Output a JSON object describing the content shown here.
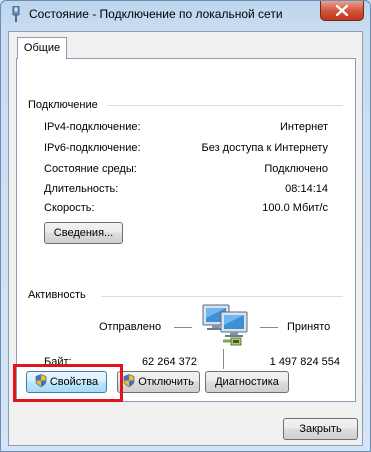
{
  "window": {
    "title": "Состояние - Подключение по локальной сети"
  },
  "tabs": [
    {
      "label": "Общие"
    }
  ],
  "connection": {
    "group_title": "Подключение",
    "rows": [
      {
        "label": "IPv4-подключение:",
        "value": "Интернет"
      },
      {
        "label": "IPv6-подключение:",
        "value": "Без доступа к Интернету"
      },
      {
        "label": "Состояние среды:",
        "value": "Подключено"
      },
      {
        "label": "Длительность:",
        "value": "08:14:14"
      },
      {
        "label": "Скорость:",
        "value": "100.0 Мбит/с"
      }
    ],
    "details_button": "Сведения..."
  },
  "activity": {
    "group_title": "Активность",
    "sent_label": "Отправлено",
    "received_label": "Принято",
    "bytes_label": "Байт:",
    "bytes_sent": "62 264 372",
    "bytes_received": "1 497 824 554"
  },
  "buttons": {
    "properties": "Свойства",
    "disable": "Отключить",
    "diagnose": "Диагностика",
    "close": "Закрыть"
  },
  "icons": {
    "title": "network-connection-icon",
    "close": "close-icon",
    "shield": "uac-shield-icon",
    "network": "network-activity-icon"
  },
  "colors": {
    "highlight": "#e0141c",
    "titlebar": "#bcd5ee",
    "close_button": "#d1573d"
  }
}
